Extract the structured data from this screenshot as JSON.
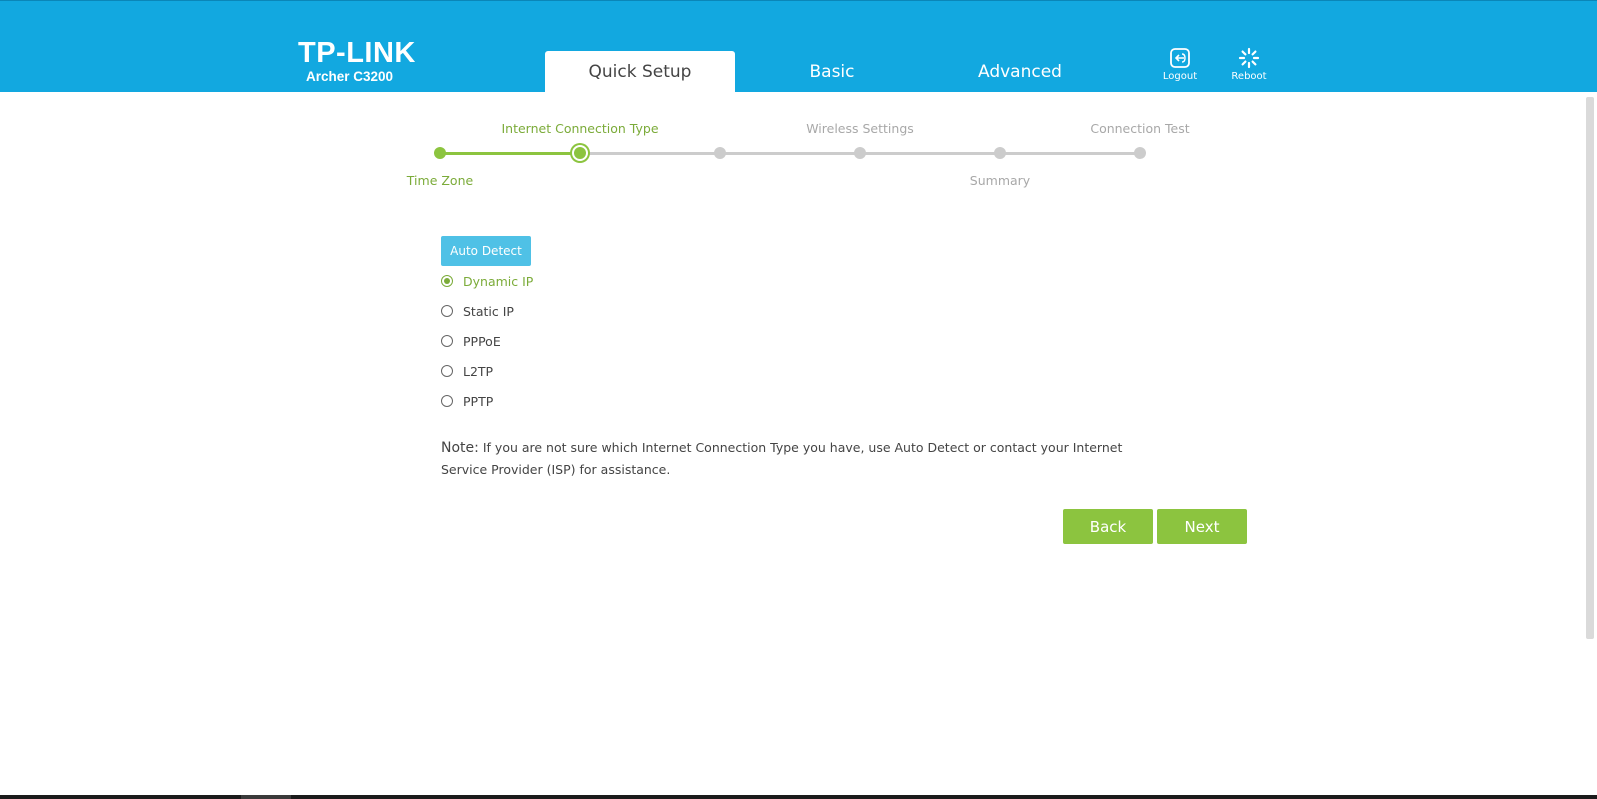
{
  "header": {
    "brand": "TP-LINK",
    "model": "Archer C3200",
    "tabs": [
      {
        "label": "Quick Setup",
        "active": true
      },
      {
        "label": "Basic",
        "active": false
      },
      {
        "label": "Advanced",
        "active": false
      }
    ],
    "logout_label": "Logout",
    "reboot_label": "Reboot"
  },
  "steps": {
    "items": [
      "Time Zone",
      "Internet Connection Type",
      "Wireless Settings",
      "Summary",
      "Connection Test"
    ],
    "current_index": 1
  },
  "form": {
    "auto_detect_label": "Auto Detect",
    "options": [
      {
        "label": "Dynamic IP",
        "selected": true
      },
      {
        "label": "Static IP",
        "selected": false
      },
      {
        "label": "PPPoE",
        "selected": false
      },
      {
        "label": "L2TP",
        "selected": false
      },
      {
        "label": "PPTP",
        "selected": false
      }
    ],
    "note_label": "Note:",
    "note_text": "If you are not sure which Internet Connection Type you have, use Auto Detect or contact your Internet Service Provider (ISP) for assistance."
  },
  "buttons": {
    "back_label": "Back",
    "next_label": "Next"
  },
  "colors": {
    "header_bg": "#12a8e0",
    "accent_green": "#8cc43f",
    "auto_detect_bg": "#4fc1e6"
  }
}
